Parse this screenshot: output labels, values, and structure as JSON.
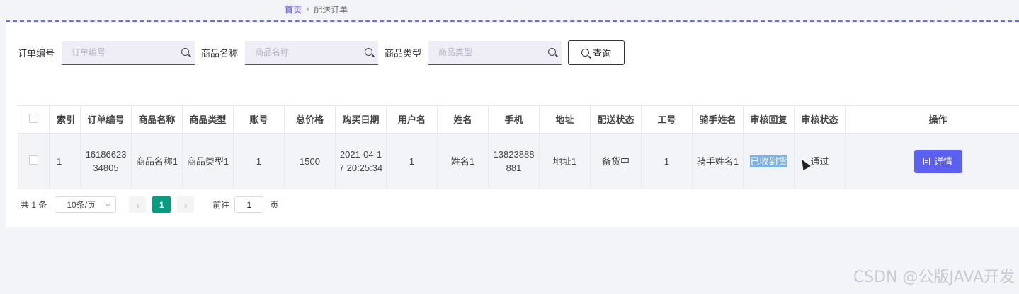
{
  "breadcrumb": {
    "home": "首页",
    "current": "配送订单"
  },
  "search": {
    "order_no_label": "订单编号",
    "order_no_placeholder": "订单编号",
    "product_name_label": "商品名称",
    "product_name_placeholder": "商品名称",
    "product_type_label": "商品类型",
    "product_type_placeholder": "商品类型",
    "query_button": "查询"
  },
  "table": {
    "headers": [
      "索引",
      "订单编号",
      "商品名称",
      "商品类型",
      "账号",
      "总价格",
      "购买日期",
      "用户名",
      "姓名",
      "手机",
      "地址",
      "配送状态",
      "工号",
      "骑手姓名",
      "审核回复",
      "审核状态",
      "操作"
    ],
    "rows": [
      [
        "1",
        "1618662334805",
        "商品名称1",
        "商品类型1",
        "1",
        "1500",
        "2021-04-17 20:25:34",
        "1",
        "姓名1",
        "13823888881",
        "地址1",
        "备货中",
        "1",
        "骑手姓名1",
        "已收到货",
        "通过"
      ]
    ],
    "detail_button": "详情"
  },
  "pagination": {
    "total": "共 1 条",
    "page_size": "10条/页",
    "current_page": "1",
    "goto_prefix": "前往",
    "goto_value": "1",
    "goto_suffix": "页"
  },
  "watermark": "CSDN @公版JAVA开发",
  "colors": {
    "accent": "#5c60f0",
    "pager_active": "#0a9b80",
    "breadcrumb": "#7b6fd6"
  }
}
